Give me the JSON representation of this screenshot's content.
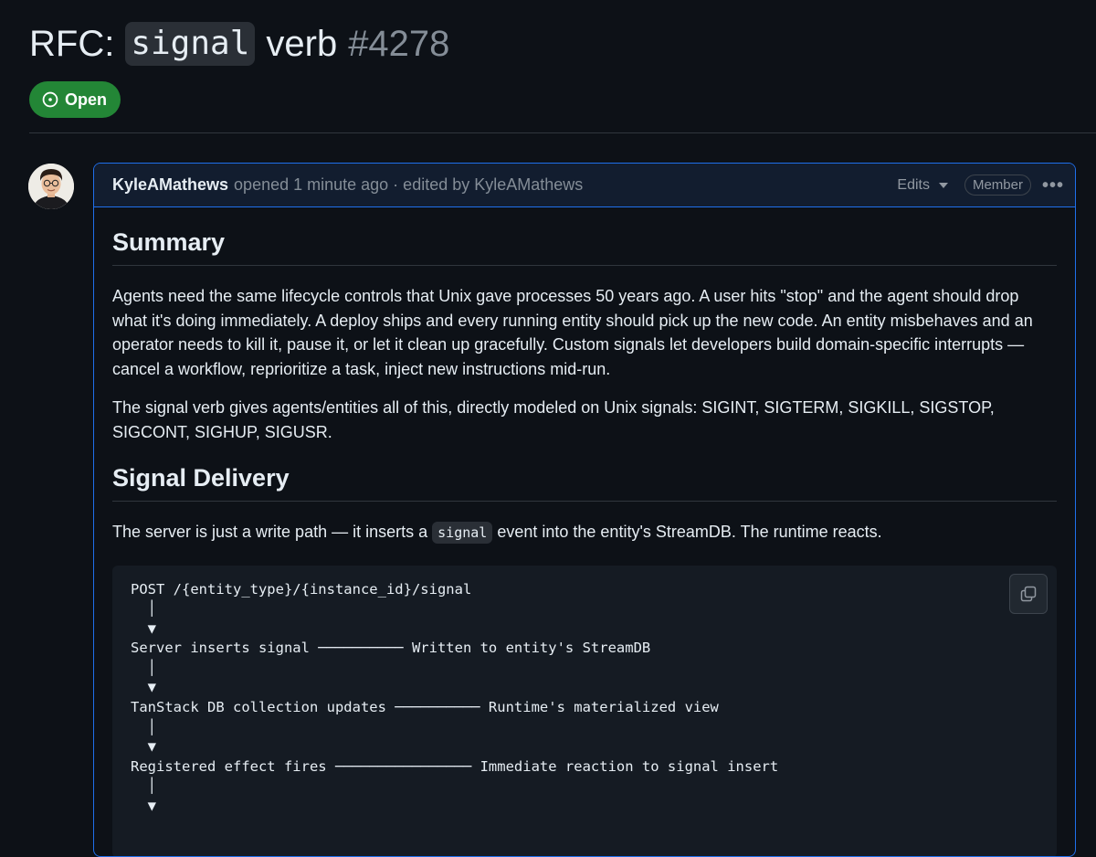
{
  "issue": {
    "title_prefix": "RFC:",
    "title_code": "signal",
    "title_suffix": "verb",
    "number": "#4278",
    "state": "Open",
    "state_color": "#238636",
    "accent_color": "#1f6feb"
  },
  "comment": {
    "author": "KyleAMathews",
    "meta": "opened 1 minute ago · edited by KyleAMathews",
    "edits_label": "Edits",
    "role_badge": "Member",
    "more_icon": "kebab-horizontal-icon",
    "avatar_icon": "user-avatar"
  },
  "body": {
    "summary_heading": "Summary",
    "summary_p1": "Agents need the same lifecycle controls that Unix gave processes 50 years ago. A user hits \"stop\" and the agent should drop what it's doing immediately. A deploy ships and every running entity should pick up the new code. An entity misbehaves and an operator needs to kill it, pause it, or let it clean up gracefully. Custom signals let developers build domain-specific interrupts — cancel a workflow, reprioritize a task, inject new instructions mid-run.",
    "summary_p2": "The signal verb gives agents/entities all of this, directly modeled on Unix signals: SIGINT, SIGTERM, SIGKILL, SIGSTOP, SIGCONT, SIGHUP, SIGUSR.",
    "delivery_heading": "Signal Delivery",
    "delivery_p_before": "The server is just a write path — it inserts a",
    "delivery_p_code": "signal",
    "delivery_p_after": "event into the entity's StreamDB. The runtime reacts.",
    "copy_icon": "copy-icon",
    "code_lines": [
      "POST /{entity_type}/{instance_id}/signal",
      "  │",
      "  ▼",
      "Server inserts signal ────────── Written to entity's StreamDB",
      "  │",
      "  ▼",
      "TanStack DB collection updates ────────── Runtime's materialized view",
      "  │",
      "  ▼",
      "Registered effect fires ──────────────── Immediate reaction to signal insert",
      "  │",
      "  ▼"
    ]
  }
}
